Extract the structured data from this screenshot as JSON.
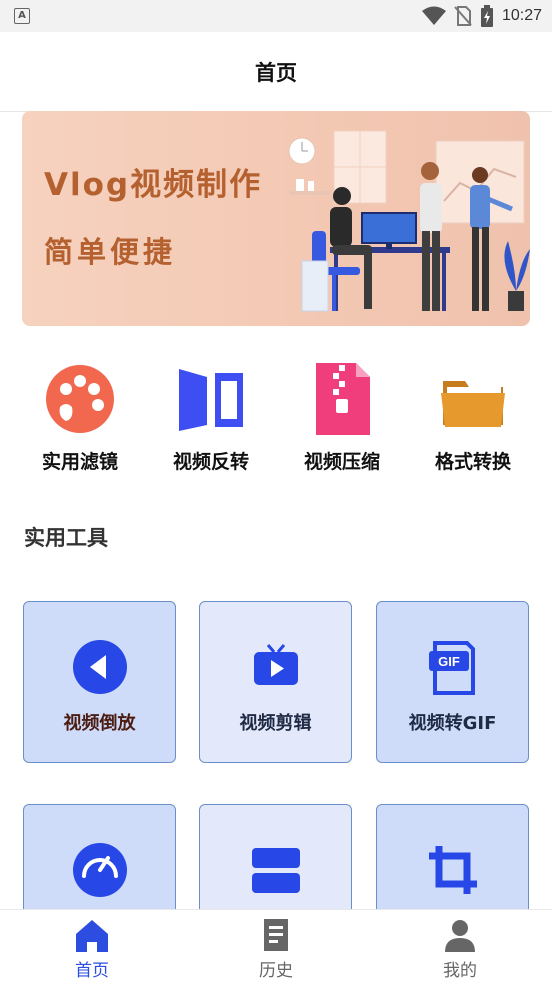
{
  "status_bar": {
    "time": "10:27",
    "icons": [
      "app-notification-icon",
      "wifi-icon",
      "no-sim-icon",
      "battery-charging-icon"
    ]
  },
  "header": {
    "title": "首页"
  },
  "banner": {
    "line1": "Vlog视频制作",
    "line2": "简单便捷"
  },
  "quick_actions": [
    {
      "label": "实用滤镜",
      "icon": "palette-icon",
      "color": "#f2684f"
    },
    {
      "label": "视频反转",
      "icon": "flip-icon",
      "color": "#3d4ff2"
    },
    {
      "label": "视频压缩",
      "icon": "zip-file-icon",
      "color": "#f03e7c"
    },
    {
      "label": "格式转换",
      "icon": "folder-icon",
      "color": "#e69a2e"
    }
  ],
  "section": {
    "title": "实用工具"
  },
  "tools": [
    {
      "label": "视频倒放",
      "icon": "play-reverse-icon"
    },
    {
      "label": "视频剪辑",
      "icon": "tv-play-icon"
    },
    {
      "label": "视频转GIF",
      "icon": "gif-file-icon",
      "badge": "GIF"
    },
    {
      "label": "",
      "icon": "speedometer-icon"
    },
    {
      "label": "",
      "icon": "split-icon"
    },
    {
      "label": "",
      "icon": "crop-icon"
    }
  ],
  "tabbar": {
    "items": [
      {
        "label": "首页",
        "icon": "home-icon",
        "active": true
      },
      {
        "label": "历史",
        "icon": "history-icon",
        "active": false
      },
      {
        "label": "我的",
        "icon": "profile-icon",
        "active": false
      }
    ]
  },
  "colors": {
    "accent": "#2d4de0",
    "card_border": "#6b8fc8",
    "card_bg": "#cfdcf9",
    "banner_text": "#b5602f"
  }
}
